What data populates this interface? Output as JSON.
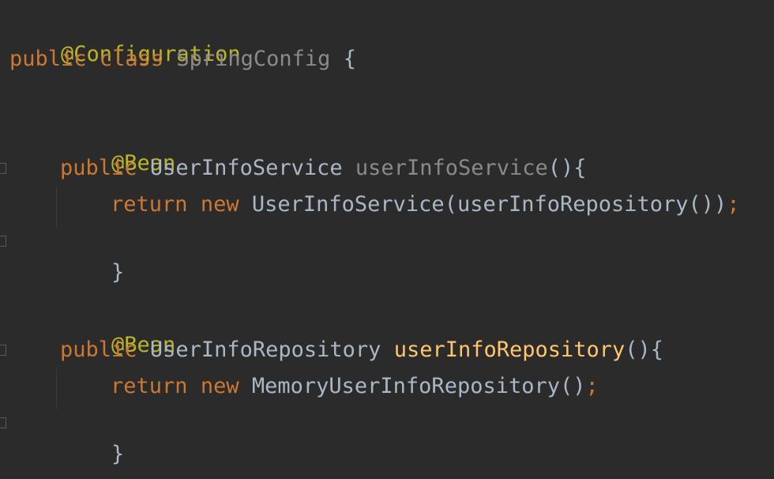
{
  "code": {
    "l1": {
      "annotation": "@Configuration"
    },
    "l2": {
      "kw1": "public",
      "kw2": "class",
      "name": "SpringConfig",
      "brace": "{"
    },
    "l4": {
      "annotation": "@Bean"
    },
    "l5": {
      "kw": "public",
      "type": "UserInfoService",
      "method": "userInfoService",
      "tail": "(){"
    },
    "l6": {
      "kw1": "return",
      "kw2": "new",
      "call": "UserInfoService(userInfoRepository())",
      "semi": ";"
    },
    "l7": {
      "brace": "}"
    },
    "l9": {
      "annotation": "@Bean"
    },
    "l10": {
      "kw": "public",
      "type": "UserInfoRepository",
      "method": "userInfoRepository",
      "tail": "(){"
    },
    "l11": {
      "kw1": "return",
      "kw2": "new",
      "call": "MemoryUserInfoRepository()",
      "semi": ";"
    },
    "l12": {
      "brace": "}"
    },
    "l13": {
      "brace": "}"
    }
  },
  "colors": {
    "background": "#2b2b2b",
    "annotation": "#bbb529",
    "keyword": "#cc7832",
    "identifier": "#a9b7c6",
    "method_declaration": "#ffc66d",
    "unused_identifier": "#8a8a8a"
  },
  "icons": [
    "fold-open-icon",
    "fold-close-icon"
  ]
}
